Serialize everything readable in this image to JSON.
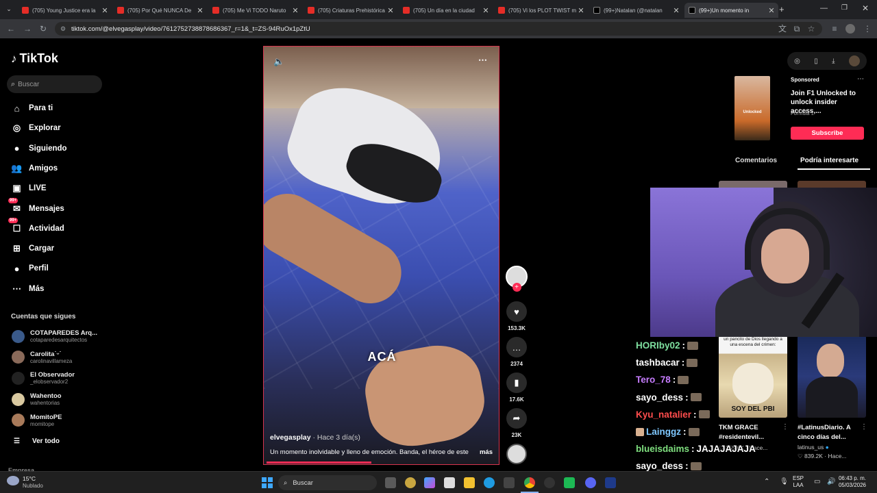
{
  "browser": {
    "tabs": [
      {
        "title": "(705) Young Justice era la",
        "type": "yt"
      },
      {
        "title": "(705) Por Qué NUNCA De",
        "type": "yt"
      },
      {
        "title": "(705) Me Vi TODO Naruto",
        "type": "yt"
      },
      {
        "title": "(705) Criaturas Prehistórica",
        "type": "yt"
      },
      {
        "title": "(705) Un día en la ciudad",
        "type": "yt"
      },
      {
        "title": "(705) Vi los PLOT TWIST m",
        "type": "yt"
      },
      {
        "title": "(99+)Natalan (@natalan",
        "type": "tt"
      },
      {
        "title": "(99+)Un momento in",
        "type": "tt",
        "active": true
      }
    ],
    "new_tab": "+",
    "url": "tiktok.com/@elvegasplay/video/7612752738878686367_r=1&_t=ZS-94RuOx1pZtU"
  },
  "sidebar": {
    "logo": "TikTok",
    "search_placeholder": "Buscar",
    "nav": [
      {
        "label": "Para ti",
        "icon": "home-icon",
        "glyph": "⌂"
      },
      {
        "label": "Explorar",
        "icon": "compass-icon",
        "glyph": "◎"
      },
      {
        "label": "Siguiendo",
        "icon": "following-icon",
        "glyph": "●"
      },
      {
        "label": "Amigos",
        "icon": "friends-icon",
        "glyph": "👥"
      },
      {
        "label": "LIVE",
        "icon": "live-icon",
        "glyph": "▣"
      },
      {
        "label": "Mensajes",
        "icon": "messages-icon",
        "glyph": "✉",
        "badge": "99+"
      },
      {
        "label": "Actividad",
        "icon": "activity-icon",
        "glyph": "☐",
        "badge": "99+"
      },
      {
        "label": "Cargar",
        "icon": "upload-icon",
        "glyph": "⊞"
      },
      {
        "label": "Perfil",
        "icon": "profile-icon",
        "glyph": "●"
      },
      {
        "label": "Más",
        "icon": "more-icon",
        "glyph": "⋯"
      }
    ],
    "following_title": "Cuentas que sigues",
    "accounts": [
      {
        "name": "COTAPAREDES Arq...",
        "handle": "cotaparedesarquitectos",
        "color": "#3a5a8a"
      },
      {
        "name": "Carolita˙ᵕ˙",
        "handle": "carolinavillameza",
        "color": "#8a6a5a"
      },
      {
        "name": "El Observador",
        "handle": "_elobservador2",
        "color": "#222"
      },
      {
        "name": "Wahentoo",
        "handle": "wahentorias",
        "color": "#d9c9a0"
      },
      {
        "name": "MomitoPE",
        "handle": "momitope",
        "color": "#a87a5a"
      }
    ],
    "see_all": "Ver todo",
    "footer": "Empresa"
  },
  "video": {
    "overlay_text": "ACÁ",
    "author": "elvegasplay",
    "time": " · Hace 3 día(s)",
    "description": "Un momento inolvidable y lleno de emoción. Banda, el héroe de este",
    "more": "más",
    "progress": 0.45
  },
  "actions": {
    "likes": "153.3K",
    "comments": "2374",
    "saves": "17.6K",
    "shares": "23K"
  },
  "right": {
    "sponsored": "Sponsored",
    "ad_title": "Join F1 Unlocked to unlock insider access,...",
    "ad_source": "Formula 1",
    "ad_thumb_text": "Unlocked",
    "subscribe": "Subscribe",
    "tab_comments": "Comentarios",
    "tab_interest": "Podría interesarte",
    "cards": [
      {
        "thumb_top": "un pancito de Dios llegando a una escena del crimen:",
        "thumb_text": "SOY DEL PBI",
        "title": "TKM GRACE #residentevil...",
        "author": "",
        "meta": "♡ 255.6K · Hace..."
      },
      {
        "thumb_top": "",
        "thumb_text": "",
        "title": "#LatinusDiario. A cinco días del...",
        "author": "latinus_us",
        "meta": "♡ 839.2K · Hace..."
      }
    ]
  },
  "chat": [
    {
      "user": "HORIby02",
      "color": "#7fe0a0",
      "msg": ""
    },
    {
      "user": "tashbacar",
      "color": "#ffffff",
      "msg": ""
    },
    {
      "user": "Tero_78",
      "color": "#c77dff",
      "msg": ""
    },
    {
      "user": "sayo_dess",
      "color": "#ffffff",
      "msg": ""
    },
    {
      "user": "Kyu_natalier",
      "color": "#ff4d4d",
      "msg": ""
    },
    {
      "user": "Lainggz",
      "color": "#7fc8ff",
      "msg": ""
    },
    {
      "user": "blueisdaims",
      "color": "#7fe07f",
      "msg": "JAJAJAJAJA"
    },
    {
      "user": "sayo_dess",
      "color": "#ffffff",
      "msg": ""
    }
  ],
  "taskbar": {
    "weather_temp": "15°C",
    "weather_desc": "Nublado",
    "search": "Buscar",
    "lang1": "ESP",
    "lang2": "LAA",
    "time": "06:43 p. m.",
    "date": "05/03/2026"
  },
  "colors": {
    "accent": "#fe2c55",
    "video_border": "#d8344e"
  }
}
